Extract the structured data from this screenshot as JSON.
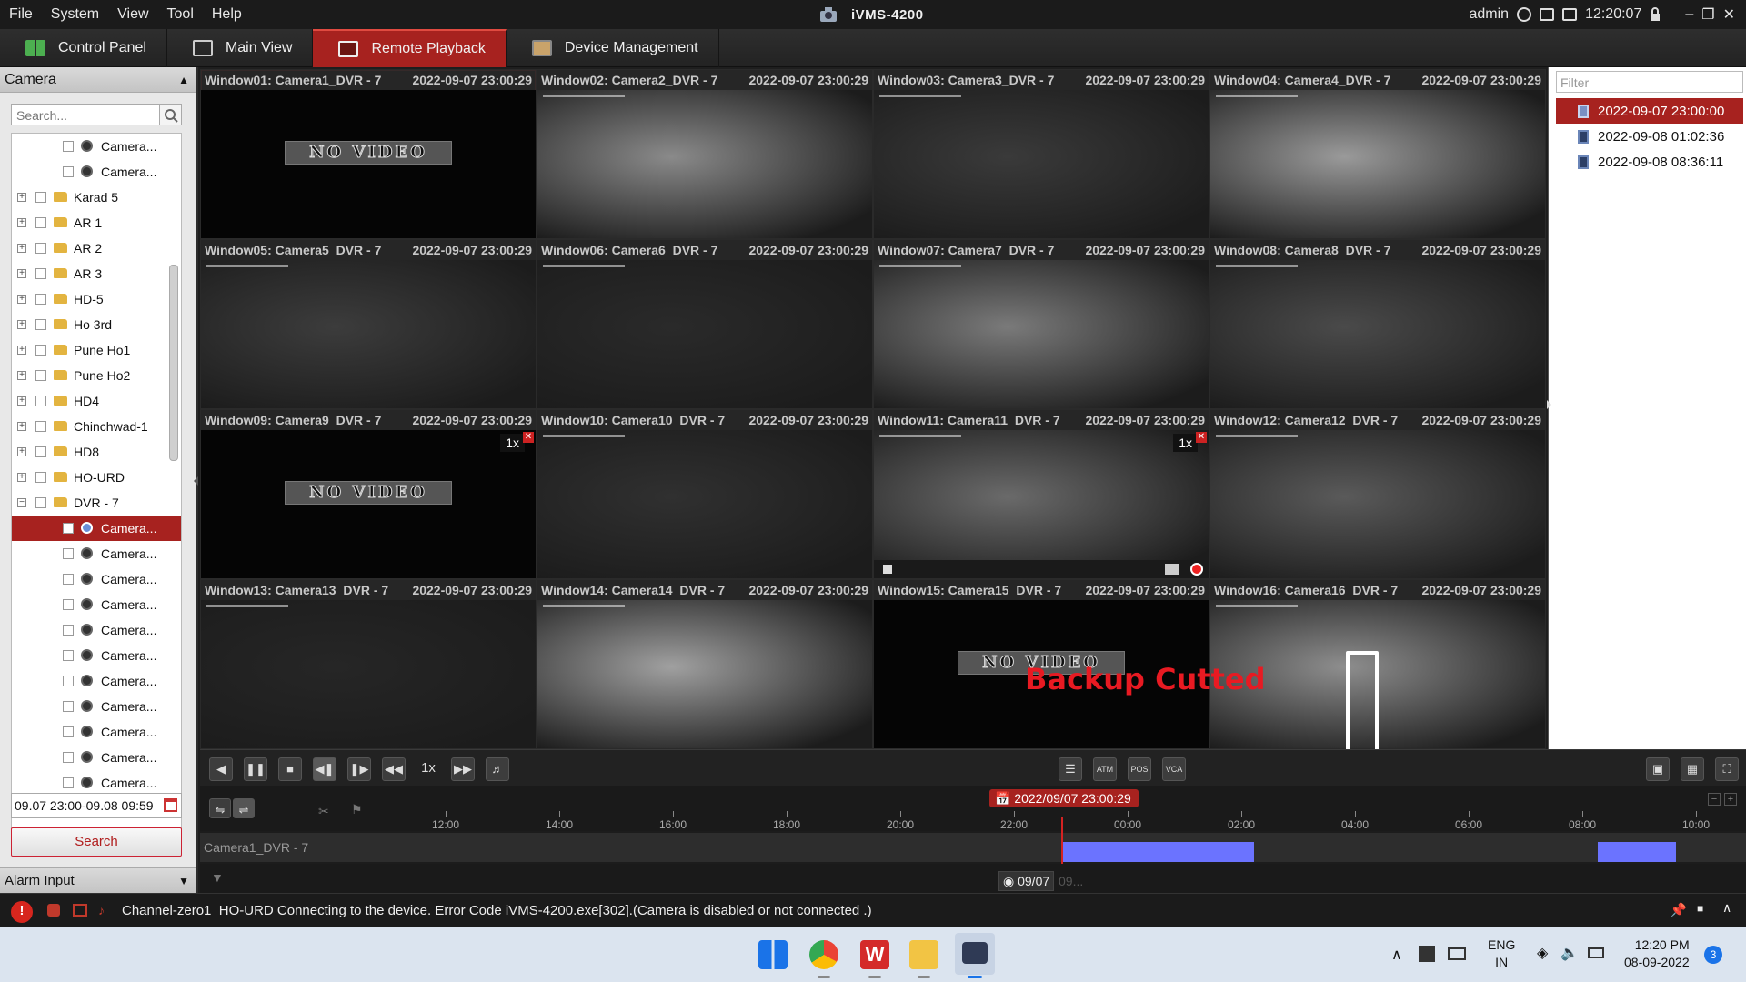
{
  "menubar": {
    "items": [
      "File",
      "System",
      "View",
      "Tool",
      "Help"
    ],
    "app_title": "iVMS-4200",
    "user": "admin",
    "clock": "12:20:07"
  },
  "toolbar": {
    "tabs": [
      {
        "label": "Control Panel",
        "icon": "grid-icon"
      },
      {
        "label": "Main View",
        "icon": "monitor-icon"
      },
      {
        "label": "Remote Playback",
        "icon": "playback-icon",
        "active": true
      },
      {
        "label": "Device Management",
        "icon": "device-icon"
      }
    ]
  },
  "left_panel": {
    "header": "Camera",
    "search_placeholder": "Search...",
    "tree": [
      {
        "label": "Camera...",
        "kind": "camera",
        "level": 2
      },
      {
        "label": "Camera...",
        "kind": "camera",
        "level": 2
      },
      {
        "label": "Karad 5",
        "kind": "folder",
        "level": 1
      },
      {
        "label": "AR 1",
        "kind": "folder",
        "level": 1
      },
      {
        "label": "AR 2",
        "kind": "folder",
        "level": 1
      },
      {
        "label": "AR 3",
        "kind": "folder",
        "level": 1
      },
      {
        "label": "HD-5",
        "kind": "folder",
        "level": 1
      },
      {
        "label": "Ho 3rd",
        "kind": "folder",
        "level": 1
      },
      {
        "label": "Pune Ho1",
        "kind": "folder",
        "level": 1
      },
      {
        "label": "Pune Ho2",
        "kind": "folder",
        "level": 1
      },
      {
        "label": "HD4",
        "kind": "folder",
        "level": 1
      },
      {
        "label": "Chinchwad-1",
        "kind": "folder",
        "level": 1
      },
      {
        "label": "HD8",
        "kind": "folder",
        "level": 1
      },
      {
        "label": "HO-URD",
        "kind": "folder",
        "level": 1
      },
      {
        "label": "DVR - 7",
        "kind": "folder",
        "level": 1,
        "expanded": true
      },
      {
        "label": "Camera...",
        "kind": "camera",
        "level": 2,
        "selected": true
      },
      {
        "label": "Camera...",
        "kind": "camera",
        "level": 2
      },
      {
        "label": "Camera...",
        "kind": "camera",
        "level": 2
      },
      {
        "label": "Camera...",
        "kind": "camera",
        "level": 2
      },
      {
        "label": "Camera...",
        "kind": "camera",
        "level": 2
      },
      {
        "label": "Camera...",
        "kind": "camera",
        "level": 2
      },
      {
        "label": "Camera...",
        "kind": "camera",
        "level": 2
      },
      {
        "label": "Camera...",
        "kind": "camera",
        "level": 2
      },
      {
        "label": "Camera...",
        "kind": "camera",
        "level": 2
      },
      {
        "label": "Camera...",
        "kind": "camera",
        "level": 2
      },
      {
        "label": "Camera...",
        "kind": "camera",
        "level": 2
      }
    ],
    "date_range": "09.07 23:00-09.08 09:59",
    "search_button": "Search",
    "alarm_header": "Alarm Input"
  },
  "windows": [
    {
      "title": "Window01:  Camera1_DVR - 7",
      "time": "2022-09-07 23:00:29",
      "no_video": true,
      "tone": "#050505"
    },
    {
      "title": "Window02:  Camera2_DVR - 7",
      "time": "2022-09-07 23:00:29",
      "tone": "#8a8a8a"
    },
    {
      "title": "Window03:  Camera3_DVR - 7",
      "time": "2022-09-07 23:00:29",
      "tone": "#3a3a3a"
    },
    {
      "title": "Window04:  Camera4_DVR - 7",
      "time": "2022-09-07 23:00:29",
      "tone": "#9a9a9a"
    },
    {
      "title": "Window05:  Camera5_DVR - 7",
      "time": "2022-09-07 23:00:29",
      "tone": "#3c3c3c"
    },
    {
      "title": "Window06:  Camera6_DVR - 7",
      "time": "2022-09-07 23:00:29",
      "tone": "#2a2a2a"
    },
    {
      "title": "Window07:  Camera7_DVR - 7",
      "time": "2022-09-07 23:00:29",
      "tone": "#7a7a7a"
    },
    {
      "title": "Window08:  Camera8_DVR - 7",
      "time": "2022-09-07 23:00:29",
      "tone": "#4a4a4a"
    },
    {
      "title": "Window09:  Camera9_DVR - 7",
      "time": "2022-09-07 23:00:29",
      "no_video": true,
      "speed": "1x",
      "tone": "#050505"
    },
    {
      "title": "Window10:  Camera10_DVR - 7",
      "time": "2022-09-07 23:00:29",
      "tone": "#303030"
    },
    {
      "title": "Window11:  Camera11_DVR - 7",
      "time": "2022-09-07 23:00:29",
      "speed": "1x",
      "tone": "#6a6a6a",
      "recording": true
    },
    {
      "title": "Window12:  Camera12_DVR - 7",
      "time": "2022-09-07 23:00:29",
      "tone": "#5a5a5a"
    },
    {
      "title": "Window13:  Camera13_DVR - 7",
      "time": "2022-09-07 23:00:29",
      "tone": "#262626"
    },
    {
      "title": "Window14:  Camera14_DVR - 7",
      "time": "2022-09-07 23:00:29",
      "tone": "#a0a0a0"
    },
    {
      "title": "Window15:  Camera15_DVR - 7",
      "time": "2022-09-07 23:00:29",
      "no_video": true,
      "tone": "#050505"
    },
    {
      "title": "Window16:  Camera16_DVR - 7",
      "time": "2022-09-07 23:00:29",
      "tone": "#8e8e8e"
    }
  ],
  "no_video_text": "NO VIDEO",
  "annotation": {
    "text": "Backup Cutted",
    "color": "#e81a22"
  },
  "right_panel": {
    "filter_placeholder": "Filter",
    "records": [
      {
        "label": "2022-09-07 23:00:00",
        "selected": true
      },
      {
        "label": "2022-09-08 01:02:36"
      },
      {
        "label": "2022-09-08 08:36:11"
      }
    ]
  },
  "controls": {
    "speed": "1x",
    "vca_label": "VCA",
    "atm_label": "ATM",
    "pos_label": "POS"
  },
  "timeline": {
    "current_tag": "2022/09/07 23:00:29",
    "ticks": [
      "12:00",
      "14:00",
      "16:00",
      "18:00",
      "20:00",
      "22:00",
      "00:00",
      "02:00",
      "04:00",
      "06:00",
      "08:00",
      "10:00"
    ],
    "track_name": "Camera1_DVR - 7",
    "date_chip": "09/07",
    "date_chip2": "09..."
  },
  "status": {
    "message": "Channel-zero1_HO-URD Connecting to the device. Error Code iVMS-4200.exe[302].(Camera is disabled or not connected .)"
  },
  "taskbar": {
    "lang": "ENG",
    "region": "IN",
    "time": "12:20 PM",
    "date": "08-09-2022",
    "badge": "3"
  },
  "colors": {
    "accent": "#a7221f",
    "segment": "#6b73ff",
    "cursor": "#d42222"
  }
}
